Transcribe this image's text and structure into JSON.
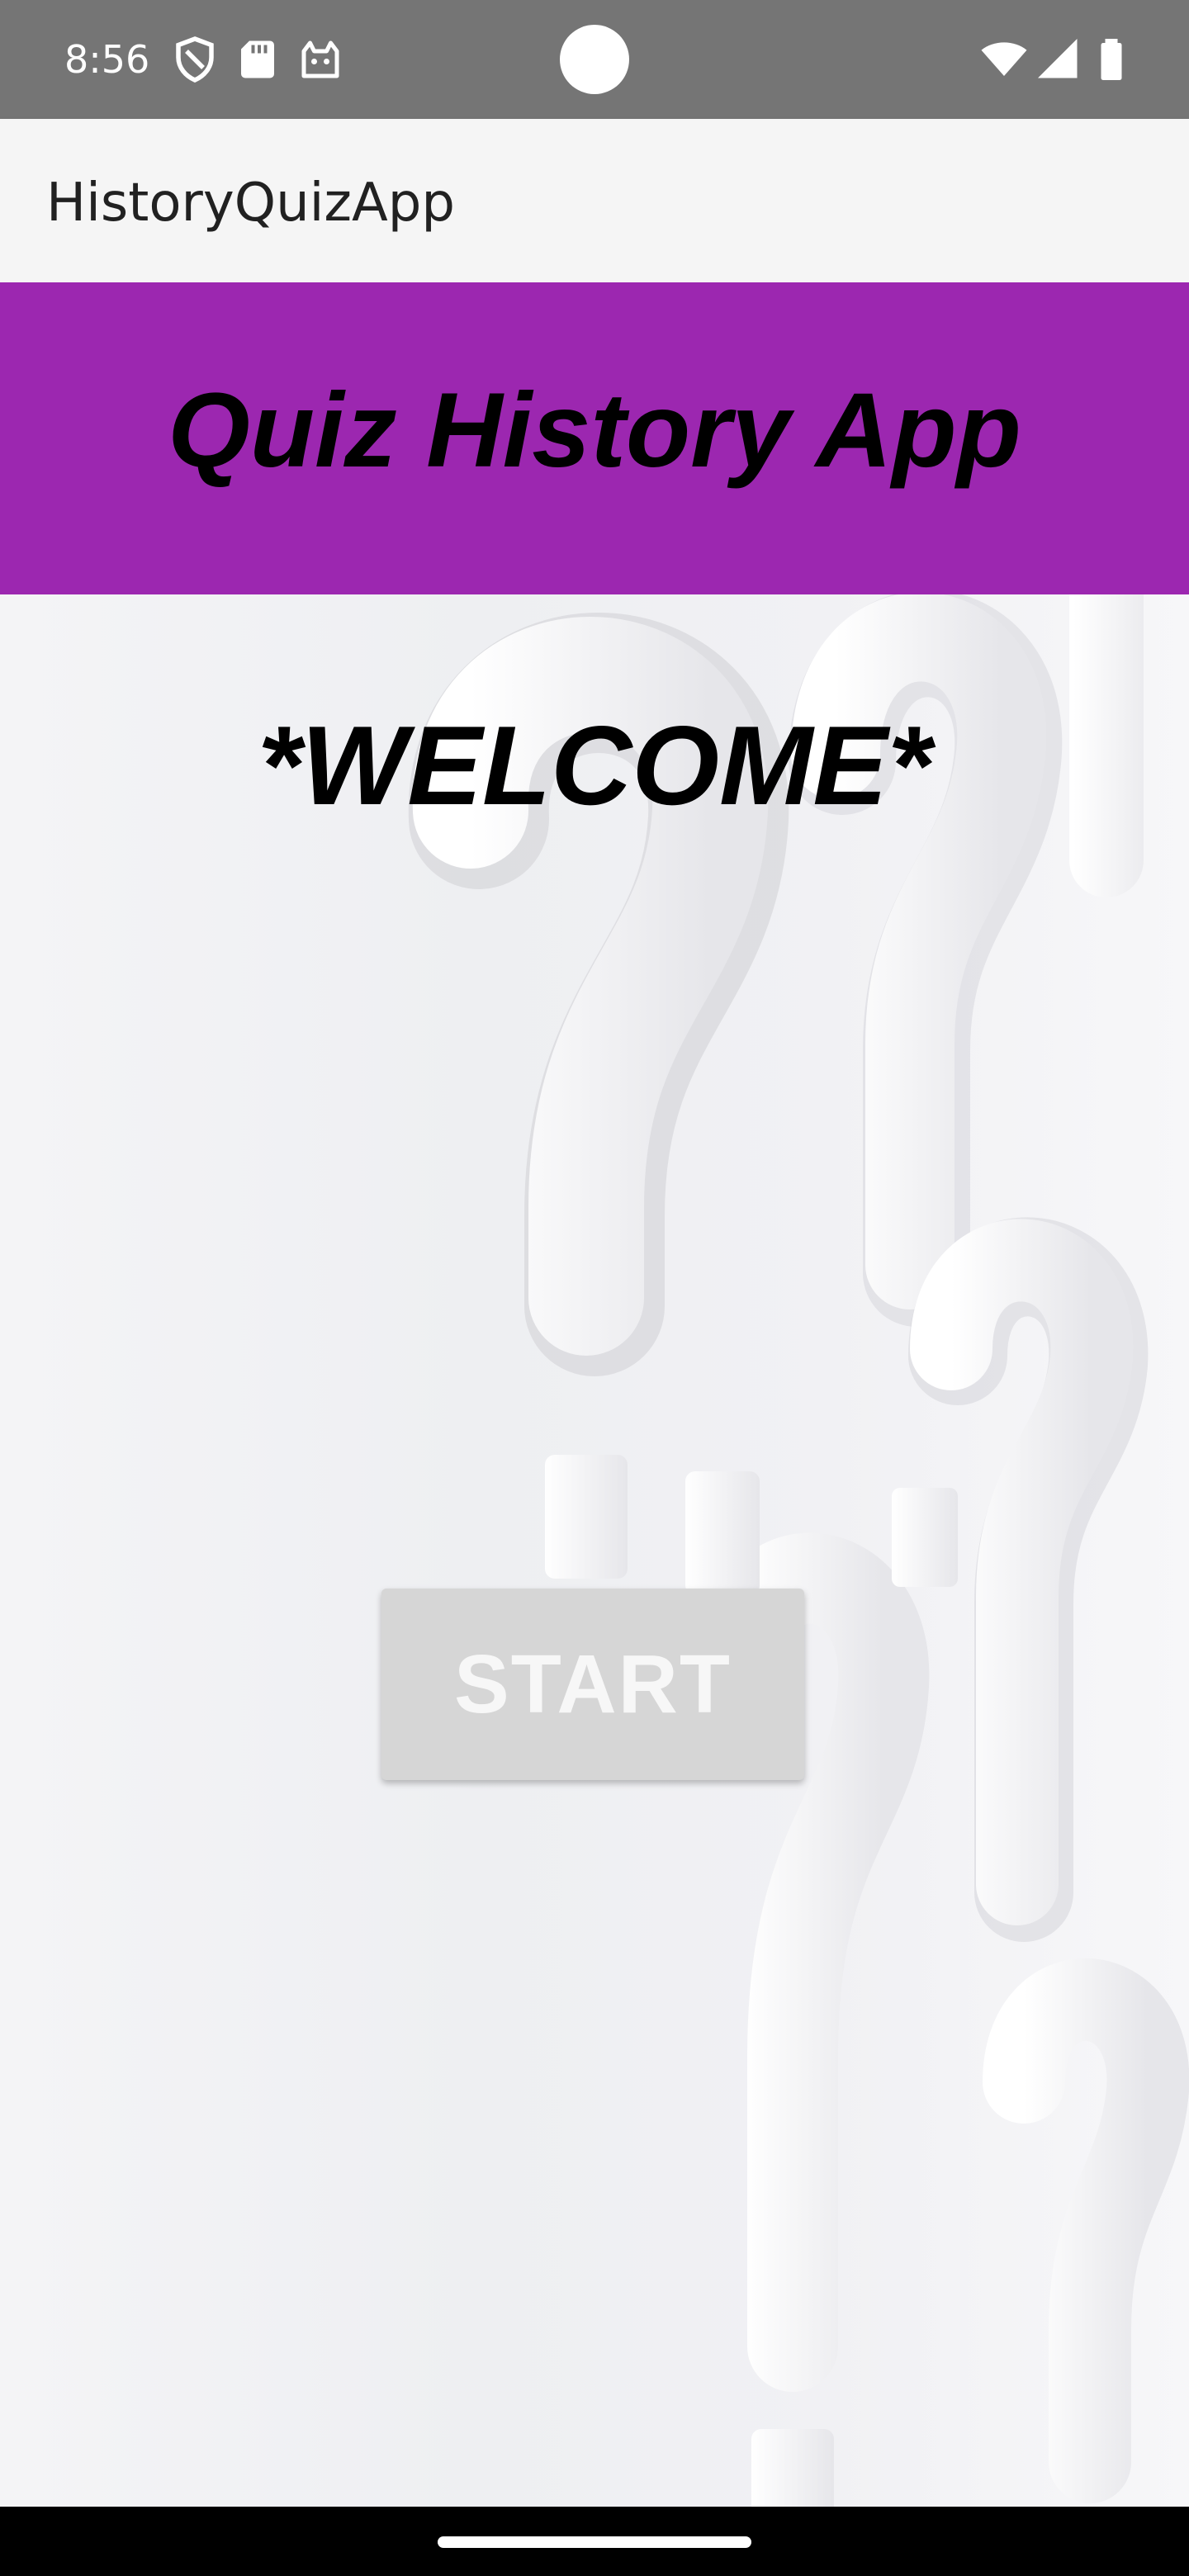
{
  "status_bar": {
    "time": "8:56",
    "left_icons": [
      "shield-icon",
      "sd-card-icon",
      "cat-face-icon"
    ],
    "right_icons": [
      "wifi-icon",
      "cellular-signal-icon",
      "battery-icon"
    ]
  },
  "app_bar": {
    "title": "HistoryQuizApp"
  },
  "header": {
    "title": "Quiz History App",
    "background": "#9c27b0"
  },
  "main": {
    "welcome": "*WELCOME*",
    "start_label": "START",
    "background_art": "question-marks-illustration"
  },
  "colors": {
    "status_bar": "#757575",
    "app_bar": "#f5f5f5",
    "accent": "#9c27b0",
    "button": "#d6d6d6",
    "nav_bar": "#000000"
  }
}
